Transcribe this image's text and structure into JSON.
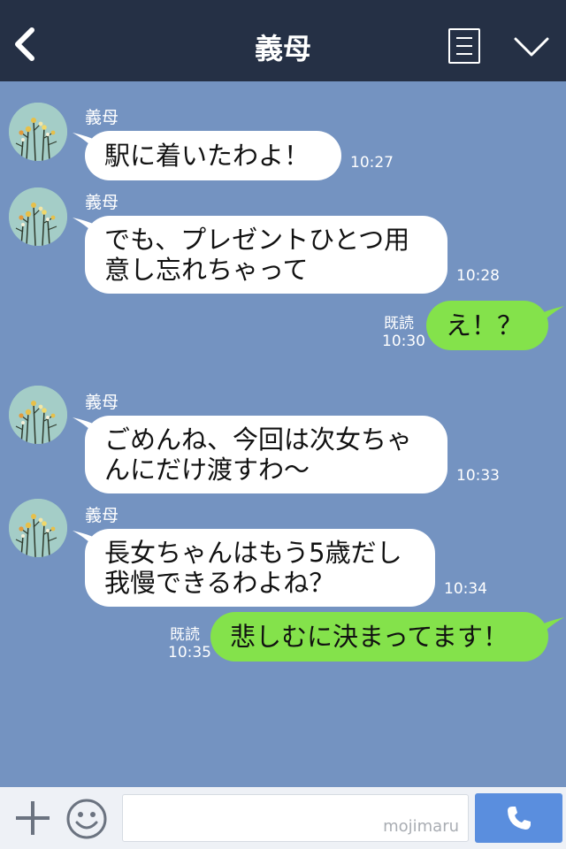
{
  "header": {
    "title": "義母"
  },
  "messages": [
    {
      "sender": "義母",
      "text_lines": [
        "駅に着いたわよ！"
      ],
      "time": "10:27"
    },
    {
      "sender": "義母",
      "text_lines": [
        "でも、プレゼントひとつ用",
        "意し忘れちゃって"
      ],
      "time": "10:28"
    },
    {
      "text_lines": [
        "え！？"
      ],
      "read": "既読",
      "time": "10:30"
    },
    {
      "sender": "義母",
      "text_lines": [
        "ごめんね、今回は次女ちゃ",
        "んにだけ渡すわ〜"
      ],
      "time": "10:33"
    },
    {
      "sender": "義母",
      "text_lines": [
        "長女ちゃんはもう5歳だし",
        "我慢できるわよね？"
      ],
      "time": "10:34"
    },
    {
      "text_lines": [
        "悲しむに決まってます！"
      ],
      "read": "既読",
      "time": "10:35"
    }
  ],
  "footer": {
    "watermark": "mojimaru"
  },
  "colors": {
    "header_bg": "#253045",
    "chat_bg": "#7493c1",
    "incoming_bubble": "#ffffff",
    "outgoing_bubble": "#84e24b",
    "send_button": "#5a8ede"
  },
  "icons": [
    "back-chevron-icon",
    "menu-icon",
    "dropdown-chevron-icon",
    "plus-icon",
    "emoji-icon",
    "phone-icon"
  ]
}
